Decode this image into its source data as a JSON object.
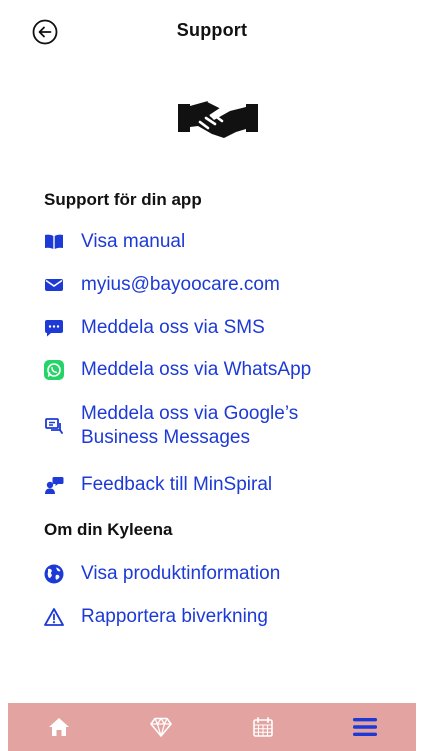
{
  "header": {
    "title": "Support"
  },
  "support_section": {
    "title": "Support för din app",
    "items": [
      {
        "label": "Visa manual",
        "icon": "book-icon"
      },
      {
        "label": "myius@bayoocare.com",
        "icon": "envelope-icon"
      },
      {
        "label": "Meddela oss via SMS",
        "icon": "sms-icon"
      },
      {
        "label": "Meddela oss via WhatsApp",
        "icon": "whatsapp-icon"
      },
      {
        "label_line1": "Meddela oss via Google’s",
        "label_line2": "Business Messages",
        "icon": "chat-icon"
      },
      {
        "label": "Feedback till MinSpiral",
        "icon": "feedback-icon"
      }
    ]
  },
  "product_section": {
    "title": "Om din Kyleena",
    "items": [
      {
        "label": "Visa produktinformation",
        "icon": "globe-icon"
      },
      {
        "label": "Rapportera biverkning",
        "icon": "warning-icon"
      }
    ]
  },
  "bottom_nav": {
    "items": [
      {
        "icon": "home-icon"
      },
      {
        "icon": "diamond-icon"
      },
      {
        "icon": "calendar-icon"
      },
      {
        "icon": "menu-icon",
        "active": true
      }
    ]
  },
  "colors": {
    "link": "#1d3ad6",
    "nav_bg": "#e3a3a0",
    "whatsapp": "#25d366"
  }
}
